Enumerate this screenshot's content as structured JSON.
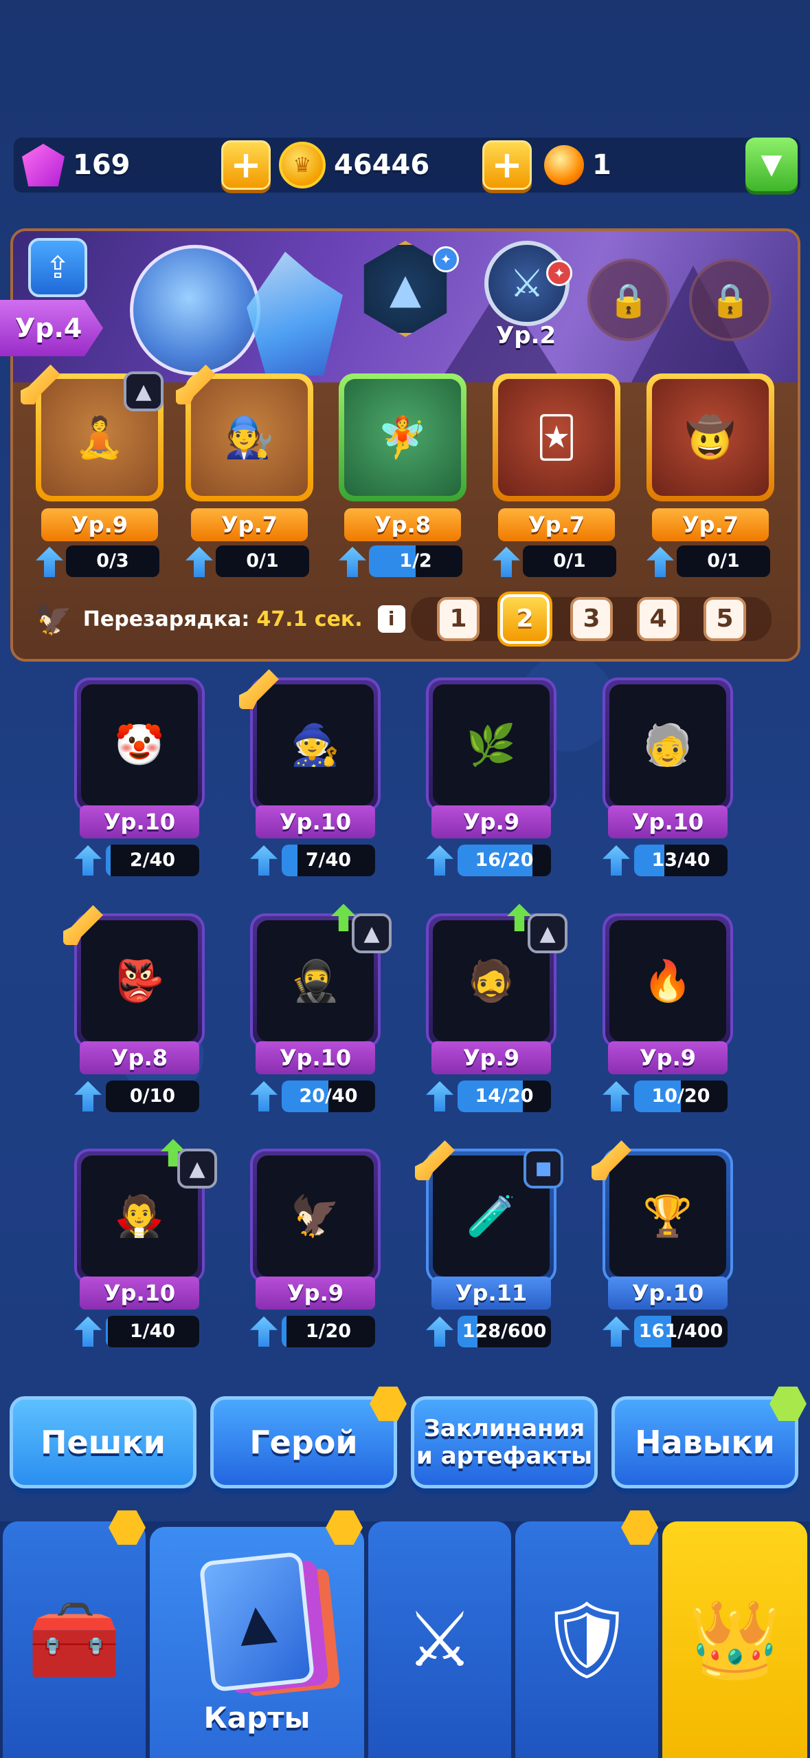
{
  "resources": {
    "gems": "169",
    "coins": "46446",
    "coin_symbol": "♛",
    "tokens": "1"
  },
  "banner": {
    "hero_level": "Ур.4",
    "skill_level": "Ур.2"
  },
  "deck_cards": [
    {
      "level": "Ур.9",
      "progress": "0/3",
      "fill": 0.0,
      "frame": "gold",
      "icon": "monk-icon",
      "emoji": "🧘"
    },
    {
      "level": "Ур.7",
      "progress": "0/1",
      "fill": 0.0,
      "frame": "gold",
      "icon": "engineer-icon",
      "emoji": "🧑‍🔧"
    },
    {
      "level": "Ур.8",
      "progress": "1/2",
      "fill": 0.5,
      "frame": "green",
      "icon": "dryad-icon",
      "emoji": "🧚"
    },
    {
      "level": "Ур.7",
      "progress": "0/1",
      "fill": 0.0,
      "frame": "orange",
      "icon": "jester-icon",
      "emoji": "🃏"
    },
    {
      "level": "Ур.7",
      "progress": "0/1",
      "fill": 0.0,
      "frame": "orange",
      "icon": "gunslinger-icon",
      "emoji": "🤠"
    }
  ],
  "reload": {
    "label": "Перезарядка:",
    "time": "47.1 сек.",
    "info": "i"
  },
  "pages": [
    "1",
    "2",
    "3",
    "4",
    "5"
  ],
  "active_page": 1,
  "collection": [
    {
      "level": "Ур.10",
      "progress": "2/40",
      "fill": 0.05,
      "style": "purple",
      "icon": "harlequin-icon",
      "emoji": "🤡"
    },
    {
      "level": "Ур.10",
      "progress": "7/40",
      "fill": 0.17,
      "style": "purple",
      "icon": "plague-doctor-icon",
      "emoji": "🧙"
    },
    {
      "level": "Ур.9",
      "progress": "16/20",
      "fill": 0.8,
      "style": "purple",
      "icon": "tree-spirit-icon",
      "emoji": "🌿"
    },
    {
      "level": "Ур.10",
      "progress": "13/40",
      "fill": 0.32,
      "style": "purple",
      "icon": "old-wizard-icon",
      "emoji": "🧓"
    },
    {
      "level": "Ур.8",
      "progress": "0/10",
      "fill": 0.0,
      "style": "purple",
      "icon": "goblin-icon",
      "emoji": "👺"
    },
    {
      "level": "Ур.10",
      "progress": "20/40",
      "fill": 0.5,
      "style": "purple",
      "icon": "assassin-icon",
      "emoji": "🥷"
    },
    {
      "level": "Ур.9",
      "progress": "14/20",
      "fill": 0.7,
      "style": "purple",
      "icon": "monk-rings-icon",
      "emoji": "🧔"
    },
    {
      "level": "Ур.9",
      "progress": "10/20",
      "fill": 0.5,
      "style": "purple",
      "icon": "fire-warrior-icon",
      "emoji": "🔥"
    },
    {
      "level": "Ур.10",
      "progress": "1/40",
      "fill": 0.02,
      "style": "purple",
      "icon": "vampire-icon",
      "emoji": "🧛"
    },
    {
      "level": "Ур.9",
      "progress": "1/20",
      "fill": 0.05,
      "style": "purple",
      "icon": "pharaoh-icon",
      "emoji": "🦅"
    },
    {
      "level": "Ур.11",
      "progress": "128/600",
      "fill": 0.21,
      "style": "blue",
      "icon": "poisoner-icon",
      "emoji": "🧪"
    },
    {
      "level": "Ур.10",
      "progress": "161/400",
      "fill": 0.4,
      "style": "blue",
      "icon": "banner-icon",
      "emoji": "🏆"
    }
  ],
  "categories": [
    {
      "line1": "Пешки",
      "line2": ""
    },
    {
      "line1": "Герой",
      "line2": ""
    },
    {
      "line1": "Заклинания",
      "line2": "и артефакты"
    },
    {
      "line1": "Навыки",
      "line2": ""
    }
  ],
  "nav": {
    "shop_icon": "treasure-chest-icon",
    "cards_label": "Карты",
    "battle_icon": "crossed-swords-icon",
    "clan_icon": "clan-shield-icon",
    "rating_icon": "laurel-crown-icon"
  },
  "colors": {
    "accent_gold": "#f39a00",
    "progress_blue": "#2f8bea",
    "card_purple": "#8a2fb2",
    "card_blue": "#2a60c8"
  }
}
